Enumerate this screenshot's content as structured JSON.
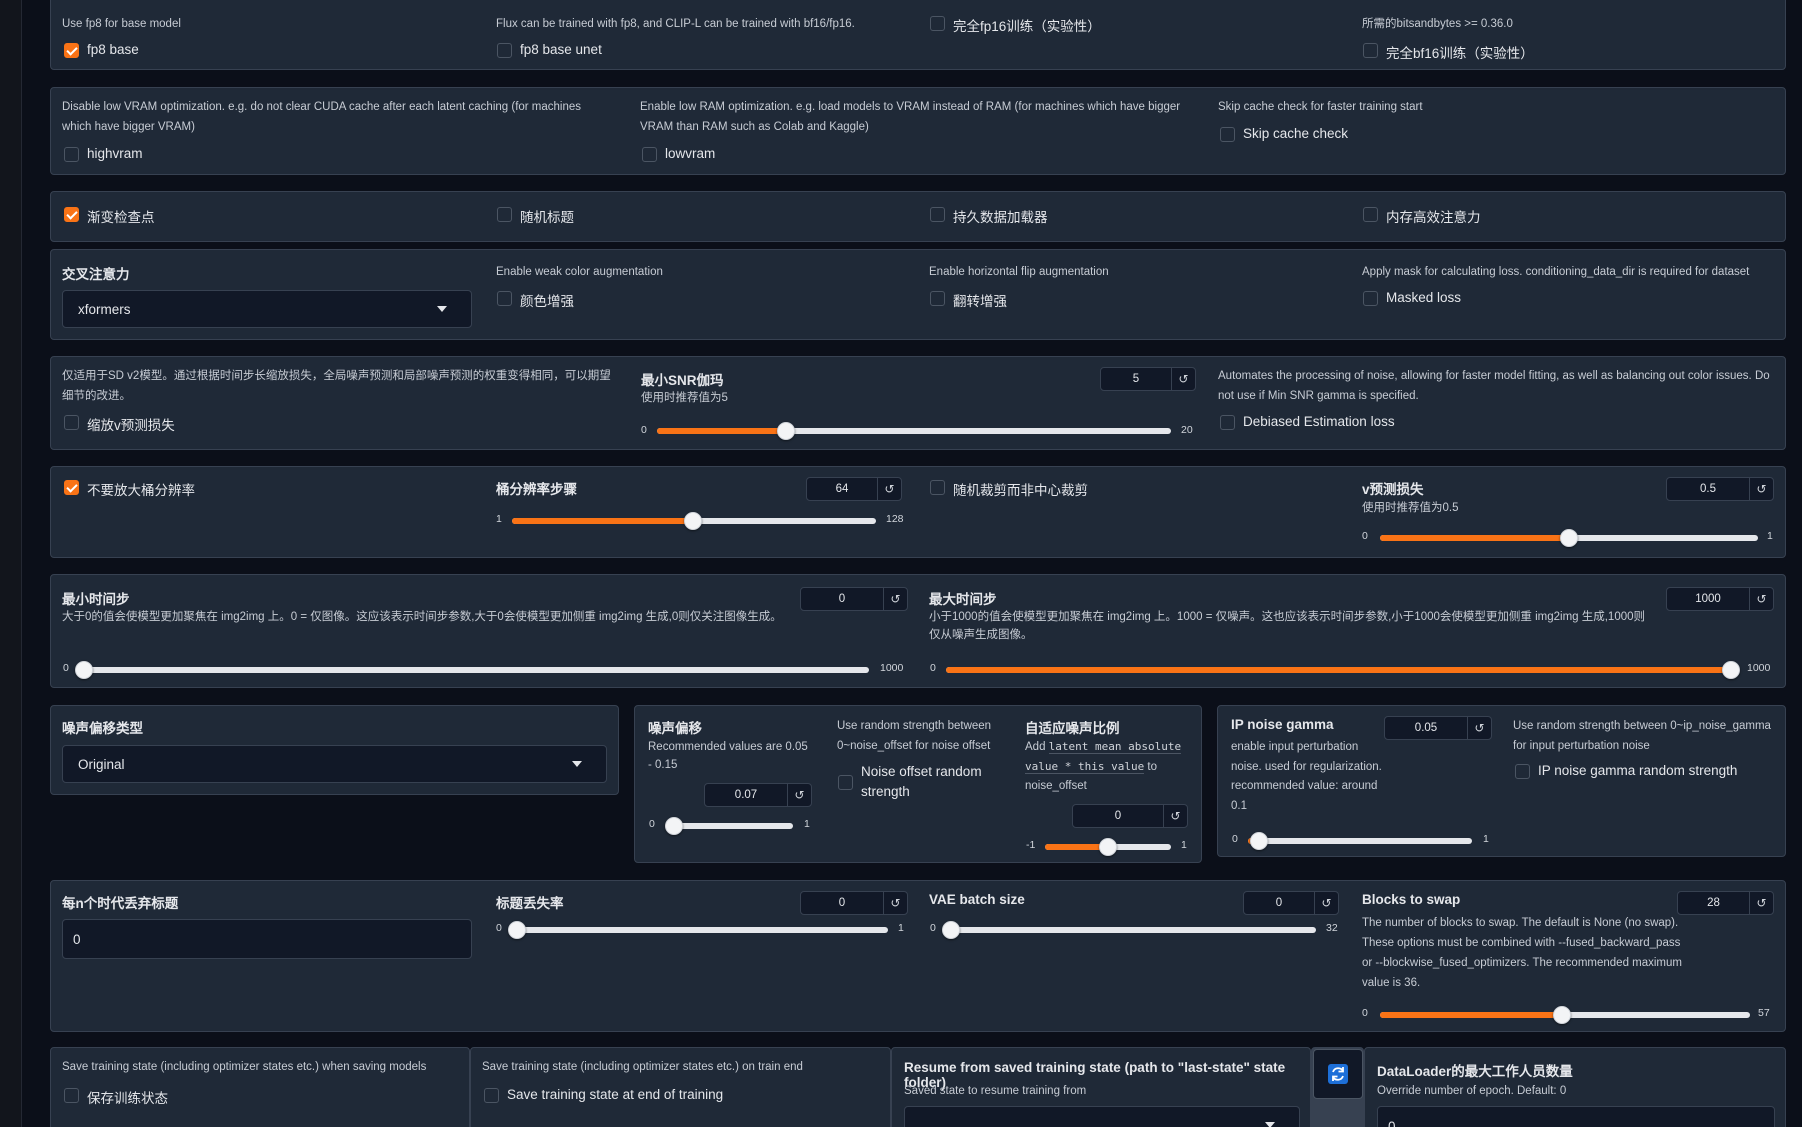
{
  "p1": {
    "fp8_info": "Use fp8 for base model",
    "fp8_base": "fp8 base",
    "flux_info": "Flux can be trained with fp8, and CLIP-L can be trained with bf16/fp16.",
    "fp8_unet": "fp8 base unet",
    "full_fp16": "完全fp16训练（实验性）",
    "bnb_info": "所需的bitsandbytes >= 0.36.0",
    "full_bf16": "完全bf16训练（实验性）"
  },
  "p2": {
    "highvram_info": "Disable low VRAM optimization. e.g. do not clear CUDA cache after each latent caching (for machines which have bigger VRAM)",
    "highvram": "highvram",
    "lowvram_info": "Enable low RAM optimization. e.g. load models to VRAM instead of RAM (for machines which have bigger VRAM than RAM such as Colab and Kaggle)",
    "lowvram": "lowvram",
    "skip_info": "Skip cache check for faster training start",
    "skip": "Skip cache check"
  },
  "p3": {
    "grad_ckpt": "渐变检查点",
    "shuffle": "随机标题",
    "persistent": "持久数据加载器",
    "mem_eff": "内存高效注意力"
  },
  "p4": {
    "cross_attn": "交叉注意力",
    "cross_attn_value": "xformers",
    "color_info": "Enable weak color augmentation",
    "color": "颜色增强",
    "flip_info": "Enable horizontal flip augmentation",
    "flip": "翻转增强",
    "mask_info": "Apply mask for calculating loss. conditioning_data_dir is required for dataset",
    "mask": "Masked loss"
  },
  "p5": {
    "vpred_info": "仅适用于SD v2模型。通过根据时间步长缩放损失，全局噪声预测和局部噪声预测的权重变得相同，可以期望细节的改进。",
    "vpred": "缩放v预测损失",
    "snr_label": "最小SNR伽玛",
    "snr_sub": "使用时推荐值为5",
    "snr_value": "5",
    "snr_min": "0",
    "snr_max": "20",
    "snr_frac": 0.25,
    "debias_info": "Automates the processing of noise, allowing for faster model fitting, as well as balancing out color issues. Do not use if Min SNR gamma is specified.",
    "debias": "Debiased Estimation loss"
  },
  "p6": {
    "no_upscale": "不要放大桶分辨率",
    "bucket_label": "桶分辨率步骤",
    "bucket_value": "64",
    "bucket_min": "1",
    "bucket_max": "128",
    "bucket_frac": 0.496,
    "random_crop": "随机裁剪而非中心裁剪",
    "vloss_label": "v预测损失",
    "vloss_sub": "使用时推荐值为0.5",
    "vloss_value": "0.5",
    "vloss_min": "0",
    "vloss_max": "1",
    "vloss_frac": 0.5
  },
  "p7": {
    "min_label": "最小时间步",
    "min_desc": "大于0的值会使模型更加聚焦在 img2img 上。0 = 仅图像。这应该表示时间步参数,大于0会使模型更加侧重 img2img 生成,0则仅关注图像生成。",
    "min_value": "0",
    "min_lo": "0",
    "min_hi": "1000",
    "min_frac": 0,
    "max_label": "最大时间步",
    "max_desc": "小于1000的值会使模型更加聚焦在 img2img 上。1000 = 仅噪声。这也应该表示时间步参数,小于1000会使模型更加侧重 img2img 生成,1000则仅从噪声生成图像。",
    "max_value": "1000",
    "max_lo": "0",
    "max_hi": "1000",
    "max_frac": 1
  },
  "p8": {
    "type_label": "噪声偏移类型",
    "type_value": "Original"
  },
  "p9": {
    "off_label": "噪声偏移",
    "off_sub": "Recommended values are 0.05 - 0.15",
    "off_value": "0.07",
    "off_lo": "0",
    "off_hi": "1",
    "off_frac": 0.07,
    "rand_info": "Use random strength between 0~noise_offset for noise offset",
    "rand": "Noise offset random strength",
    "adapt_label": "自适应噪声比例",
    "adapt_add": "Add",
    "adapt_code": "latent mean absolute value * this value",
    "adapt_to": "to noise_offset",
    "adapt_value": "0",
    "adapt_lo": "-1",
    "adapt_hi": "1",
    "adapt_frac": 0.5
  },
  "p10": {
    "ip_label": "IP noise gamma",
    "ip_sub": "enable input perturbation noise. used for regularization. recommended value: around 0.1",
    "ip_value": "0.05",
    "ip_lo": "0",
    "ip_hi": "1",
    "ip_frac": 0.05,
    "ip_rand_info": "Use random strength between 0~ip_noise_gamma for input perturbation noise",
    "ip_rand": "IP noise gamma random strength"
  },
  "p11": {
    "drop_label": "每n个时代丢弃标题",
    "drop_value": "0",
    "dropout_label": "标题丢失率",
    "dropout_value": "0",
    "dropout_lo": "0",
    "dropout_hi": "1",
    "dropout_frac": 0,
    "vae_label": "VAE batch size",
    "vae_value": "0",
    "vae_lo": "0",
    "vae_hi": "32",
    "vae_frac": 0,
    "blocks_label": "Blocks to swap",
    "blocks_desc": "The number of blocks to swap. The default is None (no swap). These options must be combined with --fused_backward_pass or --blockwise_fused_optimizers. The recommended maximum value is 36.",
    "blocks_value": "28",
    "blocks_lo": "0",
    "blocks_hi": "57",
    "blocks_frac": 0.491
  },
  "p12": {
    "save_info": "Save training state (including optimizer states etc.) when saving models",
    "save": "保存训练状态",
    "end_info": "Save training state (including optimizer states etc.) on train end",
    "end": "Save training state at end of training",
    "resume_label": "Resume from saved training state (path to \"last-state\" state folder)",
    "resume_sub": "Saved state to resume training from",
    "dl_label": "DataLoader的最大工作人员数量",
    "dl_sub": "Override number of epoch. Default: 0",
    "dl_value": "0"
  },
  "colors": {
    "accent": "#f97316",
    "panel": "#1f2937",
    "bg": "#0b0f19"
  }
}
